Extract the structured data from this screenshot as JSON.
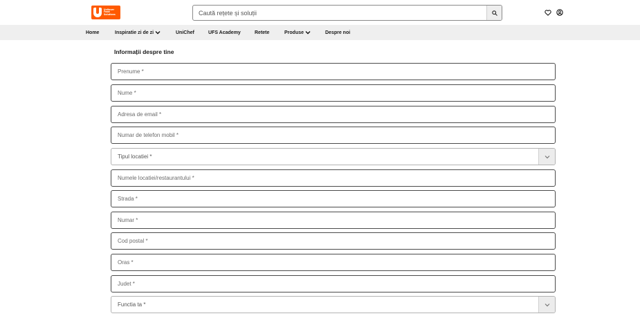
{
  "header": {
    "logo_lines": [
      "Unilever",
      "Food",
      "Solutions"
    ],
    "search_placeholder": "Caută rețete și soluții",
    "icons": [
      "search-icon",
      "heart-icon",
      "user-icon"
    ]
  },
  "nav": {
    "items": [
      {
        "label": "Home",
        "has_dropdown": false
      },
      {
        "label": "Inspiratie zi de zi",
        "has_dropdown": true
      },
      {
        "label": "UniChef",
        "has_dropdown": false
      },
      {
        "label": "UFS Academy",
        "has_dropdown": false
      },
      {
        "label": "Retete",
        "has_dropdown": false
      },
      {
        "label": "Produse",
        "has_dropdown": true
      },
      {
        "label": "Despre noi",
        "has_dropdown": false
      }
    ]
  },
  "form": {
    "section_title": "Informații despre tine",
    "fields": [
      {
        "placeholder": "Prenume *",
        "type": "text"
      },
      {
        "placeholder": "Nume *",
        "type": "text"
      },
      {
        "placeholder": "Adresa de email *",
        "type": "text"
      },
      {
        "placeholder": "Numar de telefon mobil *",
        "type": "text"
      },
      {
        "placeholder": "Tipul locatiei *",
        "type": "select"
      },
      {
        "placeholder": "Numele locatiei/restaurantului *",
        "type": "text"
      },
      {
        "placeholder": "Strada *",
        "type": "text"
      },
      {
        "placeholder": "Numar *",
        "type": "text"
      },
      {
        "placeholder": "Cod postal *",
        "type": "text"
      },
      {
        "placeholder": "Oras *",
        "type": "text"
      },
      {
        "placeholder": "Judet *",
        "type": "text"
      },
      {
        "placeholder": "Functia ta *",
        "type": "select"
      }
    ]
  },
  "colors": {
    "brand": "#ff5a00",
    "nav_background": "#efefef",
    "field_border": "#4a4a4a",
    "select_border": "#b3b3b3"
  }
}
